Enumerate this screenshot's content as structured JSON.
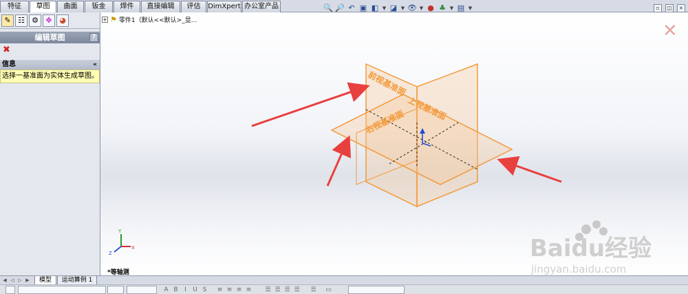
{
  "tabs": [
    {
      "label": "特征",
      "active": false
    },
    {
      "label": "草图",
      "active": true
    },
    {
      "label": "曲面",
      "active": false
    },
    {
      "label": "钣金",
      "active": false
    },
    {
      "label": "焊件",
      "active": false
    },
    {
      "label": "直接编辑",
      "active": false
    },
    {
      "label": "评估",
      "active": false
    },
    {
      "label": "DimXpert",
      "active": false
    },
    {
      "label": "办公室产品",
      "active": false
    }
  ],
  "heads_up_toolbar": [
    "zoom-to-fit-icon",
    "zoom-area-icon",
    "previous-view-icon",
    "section-view-icon",
    "view-orientation-icon",
    "display-style-icon",
    "hide-show-icon",
    "appearance-icon",
    "scene-icon",
    "view-settings-icon"
  ],
  "property_manager": {
    "title": "编辑草图",
    "help": "?",
    "cancel": "✖",
    "info_header": "信息",
    "info_collapse": "«",
    "info_message": "选择一基准面为实体生成草图。"
  },
  "tree": {
    "expand": "+",
    "part_label": "零件1（默认<<默认>_显..."
  },
  "graphics": {
    "plane_labels": {
      "front": "前视基准面",
      "top": "上视基准面",
      "right": "右视基准面"
    },
    "view_label": "*等轴测",
    "triad": {
      "x": "X",
      "y": "Y",
      "z": "Z"
    },
    "plane_color": "#f39a3a",
    "arrow_color": "#e8403e"
  },
  "model_tabs": [
    "模型",
    "运动算例 1"
  ],
  "format_bar": {
    "bold": "B",
    "italic": "I",
    "underline": "U",
    "strike": "S",
    "a_label": "A"
  },
  "watermark": {
    "brand": "Baidu经验",
    "url": "jingyan.baidu.com"
  }
}
